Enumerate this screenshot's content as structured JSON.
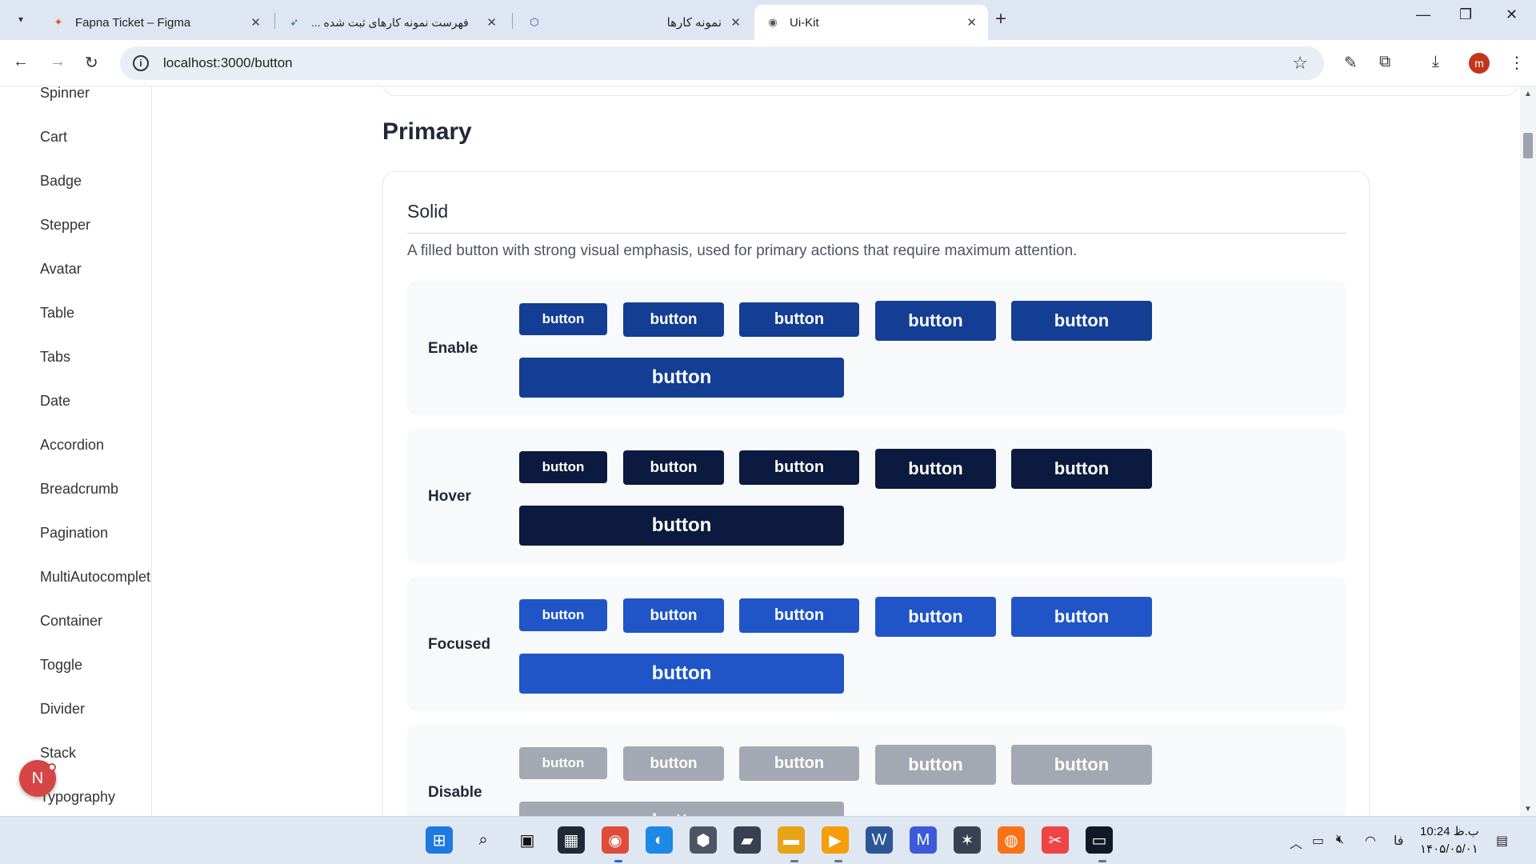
{
  "browser": {
    "tabs": [
      {
        "title": "Fapna Ticket – Figma",
        "icon": "figma-icon"
      },
      {
        "title": "فهرست نمونه کارهای ثبت شده ...",
        "icon": "bolt-icon"
      },
      {
        "title": "",
        "icon": "app-icon"
      },
      {
        "title": "نمونه کارها",
        "icon": "page-icon"
      },
      {
        "title": "Ui-Kit",
        "icon": "globe-icon"
      }
    ],
    "url": "localhost:3000/button",
    "profile_initial": "m"
  },
  "sidebar": {
    "items": [
      "Spinner",
      "Cart",
      "Badge",
      "Stepper",
      "Avatar",
      "Table",
      "Tabs",
      "Date",
      "Accordion",
      "Breadcrumb",
      "Pagination",
      "MultiAutocomplete",
      "Container",
      "Toggle",
      "Divider",
      "Stack",
      "Typography"
    ],
    "fab_initial": "N"
  },
  "main": {
    "section_title": "Primary",
    "card": {
      "title": "Solid",
      "description": "A filled button with strong visual emphasis, used for primary actions that require maximum attention.",
      "button_label": "button",
      "states": [
        {
          "label": "Enable",
          "color": "#133e94"
        },
        {
          "label": "Hover",
          "color": "#0b1a3e"
        },
        {
          "label": "Focused",
          "color": "#1f55c7"
        },
        {
          "label": "Disable",
          "color": "#a3a8b3"
        }
      ]
    }
  },
  "taskbar": {
    "clock_time": "10:24 ب.ظ",
    "clock_date": "۱۴۰۵/۰۵/۰۱",
    "lang": "فا",
    "apps": [
      "start-icon",
      "search-icon",
      "task-view-icon",
      "widgets-icon",
      "chrome-icon",
      "edge-icon",
      "box-icon",
      "store-icon",
      "explorer-icon",
      "media-icon",
      "word-icon",
      "vscode-icon",
      "inkscape-icon",
      "color-icon",
      "snip-icon",
      "terminal-icon"
    ]
  }
}
